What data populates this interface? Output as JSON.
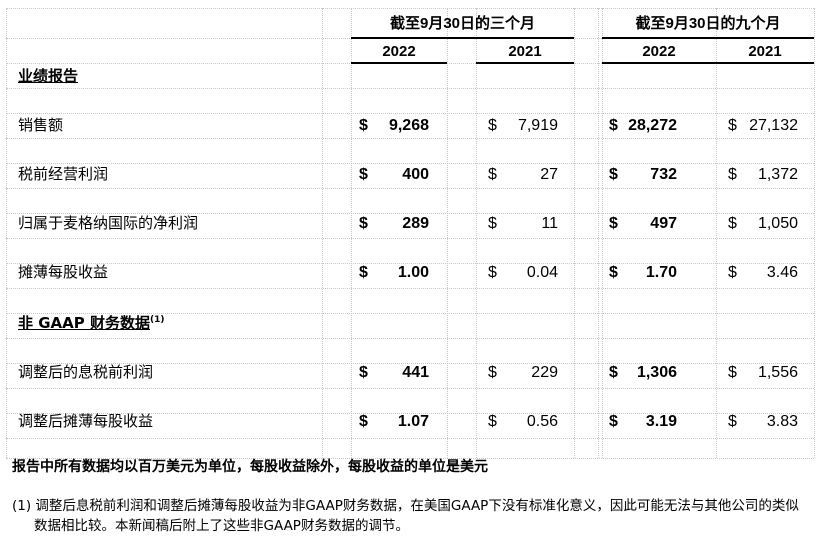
{
  "header": {
    "group1": "截至9月30日的三个月",
    "group2": "截至9月30日的九个月",
    "years": [
      "2022",
      "2021",
      "2022",
      "2021"
    ]
  },
  "sections": {
    "reporting": "业绩报告",
    "non_gaap": "非 GAAP 财务数据",
    "non_gaap_note": "(1)"
  },
  "currency_symbol": "$",
  "rows": [
    {
      "label": "销售额",
      "values": [
        "9,268",
        "7,919",
        "28,272",
        "27,132"
      ]
    },
    {
      "label": "税前经营利润",
      "values": [
        "400",
        "27",
        "732",
        "1,372"
      ]
    },
    {
      "label": "归属于麦格纳国际的净利润",
      "values": [
        "289",
        "11",
        "497",
        "1,050"
      ]
    },
    {
      "label": "摊薄每股收益",
      "values": [
        "1.00",
        "0.04",
        "1.70",
        "3.46"
      ]
    },
    {
      "label": "调整后的息税前利润",
      "values": [
        "441",
        "229",
        "1,306",
        "1,556"
      ]
    },
    {
      "label": "调整后摊薄每股收益",
      "values": [
        "1.07",
        "0.56",
        "3.19",
        "3.83"
      ]
    }
  ],
  "unit_note": "报告中所有数据均以百万美元为单位，每股收益除外，每股收益的单位是美元",
  "footnote": {
    "marker": "(1)",
    "line1": "调整后息税前利润和调整后摊薄每股收益为非GAAP财务数据，在美国GAAP下没有标准化意义，因此可能无法与其他公司的类似",
    "line2": "数据相比较。本新闻稿后附上了这些非GAAP财务数据的调节。"
  }
}
